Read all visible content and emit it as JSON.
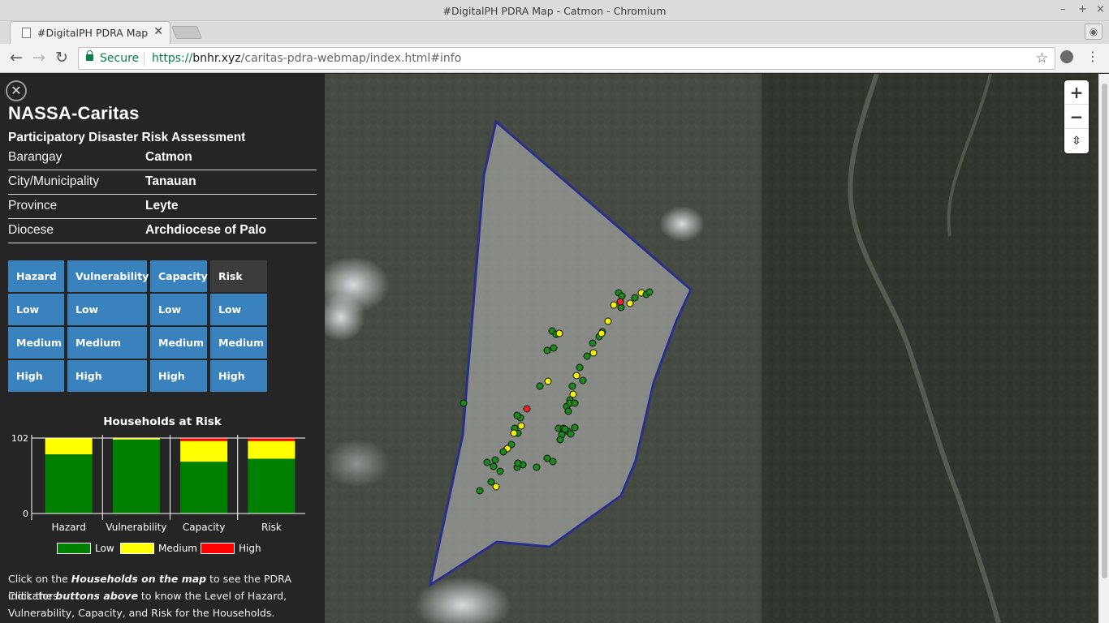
{
  "browser": {
    "window_title": "#DigitalPH PDRA Map - Catmon - Chromium",
    "tab_title": "#DigitalPH PDRA Map - C",
    "secure_label": "Secure",
    "url_scheme": "https://",
    "url_host": "bnhr.xyz",
    "url_path": "/caritas-pdra-webmap/index.html#info"
  },
  "panel": {
    "org": "NASSA-Caritas",
    "subtitle": "Participatory Disaster Risk Assessment",
    "info": [
      {
        "label": "Barangay",
        "value": "Catmon"
      },
      {
        "label": "City/Municipality",
        "value": "Tanauan"
      },
      {
        "label": "Province",
        "value": "Leyte"
      },
      {
        "label": "Diocese",
        "value": "Archdiocese of Palo"
      }
    ],
    "buttons": {
      "hazard": "Hazard",
      "vulnerability": "Vulnerability",
      "capacity": "Capacity",
      "risk": "Risk",
      "low": "Low",
      "medium": "Medium",
      "high": "High"
    },
    "note_line1_pre": "Click on the ",
    "note_line1_em": "Households on the map",
    "note_line1_post": " to see the PDRA indicators.",
    "note_line2_pre": "Click the ",
    "note_line2_em": "buttons above",
    "note_line2_post": " to know the Level of Hazard, Vulnerability, Capacity, and Risk for the Households."
  },
  "chart_data": {
    "type": "bar",
    "stacked": true,
    "title": "Households at Risk",
    "categories": [
      "Hazard",
      "Vulnerability",
      "Capacity",
      "Risk"
    ],
    "series": [
      {
        "name": "Low",
        "color": "#008000",
        "values": [
          80,
          100,
          70,
          74
        ]
      },
      {
        "name": "Medium",
        "color": "#ffff00",
        "values": [
          22,
          2,
          28,
          24
        ]
      },
      {
        "name": "High",
        "color": "#ff0000",
        "values": [
          0,
          0,
          4,
          4
        ]
      }
    ],
    "yticks": [
      "0",
      "102"
    ],
    "ylim": [
      0,
      102
    ],
    "legend": "bottom"
  },
  "map": {
    "zoom_in": "+",
    "zoom_out": "−",
    "reset_north": "⇳"
  }
}
